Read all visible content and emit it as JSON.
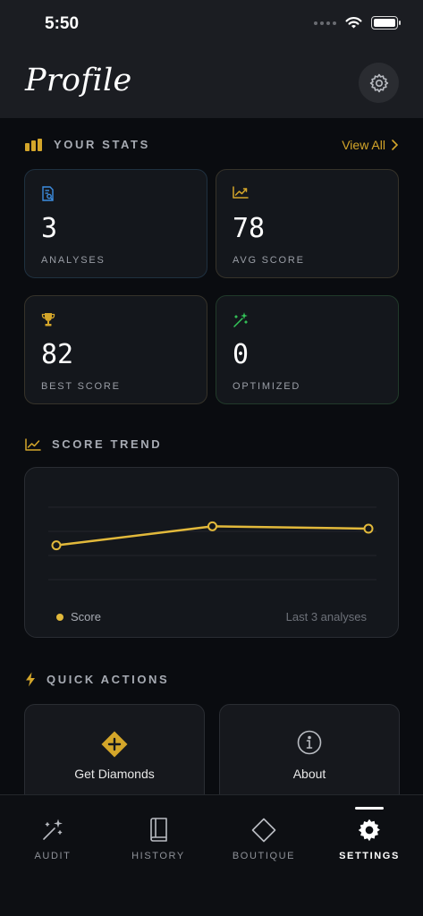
{
  "status_bar": {
    "time": "5:50"
  },
  "header": {
    "title": "Profile",
    "settings_icon": "gear-icon"
  },
  "stats": {
    "section_title": "YOUR STATS",
    "view_all": "View All",
    "cards": [
      {
        "value": "3",
        "label": "ANALYSES",
        "icon": "document-search-icon",
        "accent": "#3d8de0"
      },
      {
        "value": "78",
        "label": "AVG SCORE",
        "icon": "trend-chart-icon",
        "accent": "#d4a62a"
      },
      {
        "value": "82",
        "label": "BEST SCORE",
        "icon": "trophy-icon",
        "accent": "#d4a62a"
      },
      {
        "value": "0",
        "label": "OPTIMIZED",
        "icon": "magic-wand-icon",
        "accent": "#34c759"
      }
    ]
  },
  "trend": {
    "section_title": "SCORE TREND",
    "legend": "Score",
    "note": "Last 3 analyses",
    "line_color": "#e2b93b"
  },
  "chart_data": {
    "type": "line",
    "title": "",
    "xlabel": "",
    "ylabel": "",
    "grid": true,
    "series": [
      {
        "name": "Score",
        "values": [
          74,
          82,
          81
        ]
      }
    ]
  },
  "quick_actions": {
    "section_title": "QUICK ACTIONS",
    "items": [
      {
        "label": "Get Diamonds",
        "icon": "diamond-plus-icon"
      },
      {
        "label": "About",
        "icon": "info-icon"
      }
    ]
  },
  "tabbar": {
    "items": [
      {
        "label": "AUDIT",
        "icon": "sparkle-wand-icon"
      },
      {
        "label": "HISTORY",
        "icon": "book-icon"
      },
      {
        "label": "BOUTIQUE",
        "icon": "diamond-icon"
      },
      {
        "label": "SETTINGS",
        "icon": "gear-icon"
      }
    ],
    "active": "SETTINGS"
  },
  "colors": {
    "accent": "#d4a62a",
    "background": "#0a0c10",
    "card": "#14171c"
  }
}
